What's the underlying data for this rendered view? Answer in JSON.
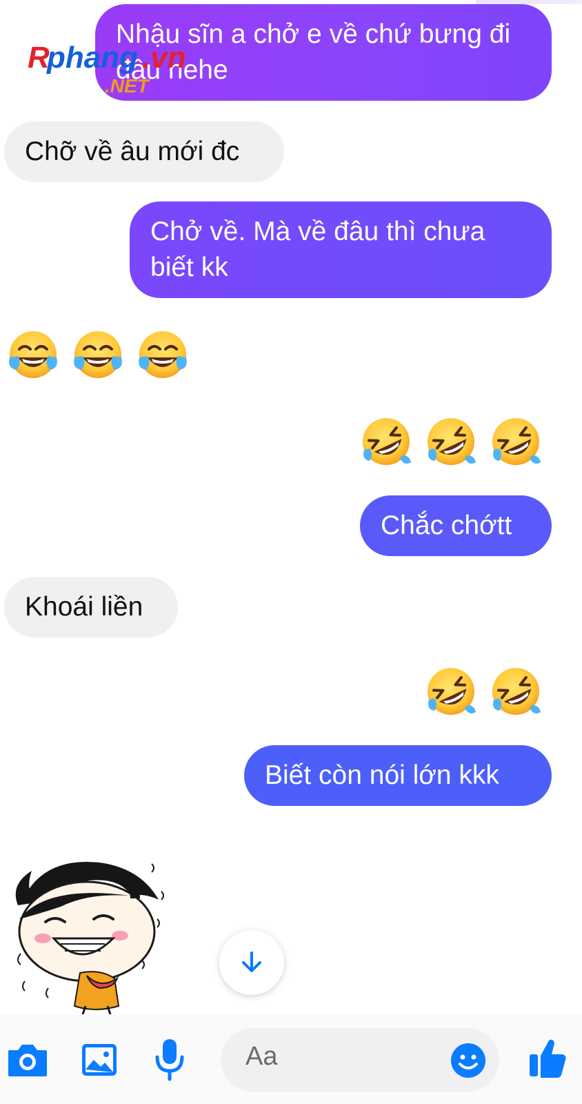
{
  "watermark": {
    "brand": "Rphang.vn",
    "suffix": ".NET"
  },
  "messages": [
    {
      "id": "m1",
      "side": "outgoing",
      "text": "Nhậu sĩn a chở e về chứ bưng đi đâu hehe"
    },
    {
      "id": "m2",
      "side": "incoming",
      "text": "Chỡ về âu mới đc"
    },
    {
      "id": "m3",
      "side": "outgoing",
      "text": "Chở về. Mà về đâu thì chưa biết kk"
    },
    {
      "id": "m4",
      "side": "incoming",
      "type": "emoji",
      "emoji": [
        "face-with-tears-of-joy",
        "face-with-tears-of-joy",
        "face-with-tears-of-joy"
      ]
    },
    {
      "id": "m5",
      "side": "outgoing",
      "type": "emoji",
      "emoji": [
        "rolling-on-the-floor-laughing",
        "rolling-on-the-floor-laughing",
        "rolling-on-the-floor-laughing"
      ]
    },
    {
      "id": "m6",
      "side": "outgoing",
      "text": "Chắc chớtt"
    },
    {
      "id": "m7",
      "side": "incoming",
      "text": "Khoái liền"
    },
    {
      "id": "m8",
      "side": "outgoing",
      "type": "emoji",
      "emoji": [
        "rolling-on-the-floor-laughing",
        "rolling-on-the-floor-laughing"
      ]
    },
    {
      "id": "m9",
      "side": "outgoing",
      "text": "Biết còn nói lớn kkk"
    },
    {
      "id": "m10",
      "side": "incoming",
      "type": "sticker",
      "sticker": "laughing-cartoon-girl-sticker"
    }
  ],
  "composer": {
    "placeholder": "Aa",
    "icons": [
      "camera-icon",
      "image-icon",
      "microphone-icon",
      "emoji-icon",
      "thumbs-up-icon"
    ]
  },
  "colors": {
    "outgoing_purple": "#8b45fb",
    "outgoing_blue": "#4d5ff9",
    "incoming_gray": "#f0f0f0",
    "messenger_blue": "#0a7cff"
  }
}
